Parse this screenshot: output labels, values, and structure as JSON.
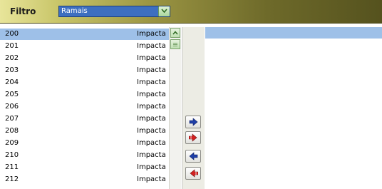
{
  "filter": {
    "label": "Filtro",
    "selected": "Ramais"
  },
  "list": {
    "selected_index": 0,
    "rows": [
      {
        "number": "200",
        "name": "Impacta"
      },
      {
        "number": "201",
        "name": "Impacta"
      },
      {
        "number": "202",
        "name": "Impacta"
      },
      {
        "number": "203",
        "name": "Impacta"
      },
      {
        "number": "204",
        "name": "Impacta"
      },
      {
        "number": "205",
        "name": "Impacta"
      },
      {
        "number": "206",
        "name": "Impacta"
      },
      {
        "number": "207",
        "name": "Impacta"
      },
      {
        "number": "208",
        "name": "Impacta"
      },
      {
        "number": "209",
        "name": "Impacta"
      },
      {
        "number": "210",
        "name": "Impacta"
      },
      {
        "number": "211",
        "name": "Impacta"
      },
      {
        "number": "212",
        "name": "Impacta"
      }
    ]
  },
  "buttons": [
    {
      "icon": "arrow-right-blue-icon",
      "color": "#1f3fa8"
    },
    {
      "icon": "double-arrow-right-red-icon",
      "color": "#d42020"
    },
    {
      "icon": "arrow-left-blue-icon",
      "color": "#1f3fa8"
    },
    {
      "icon": "double-arrow-left-red-icon",
      "color": "#d42020"
    }
  ],
  "colors": {
    "selection": "#9ec0e8",
    "dropdown": "#3d6fc0"
  }
}
